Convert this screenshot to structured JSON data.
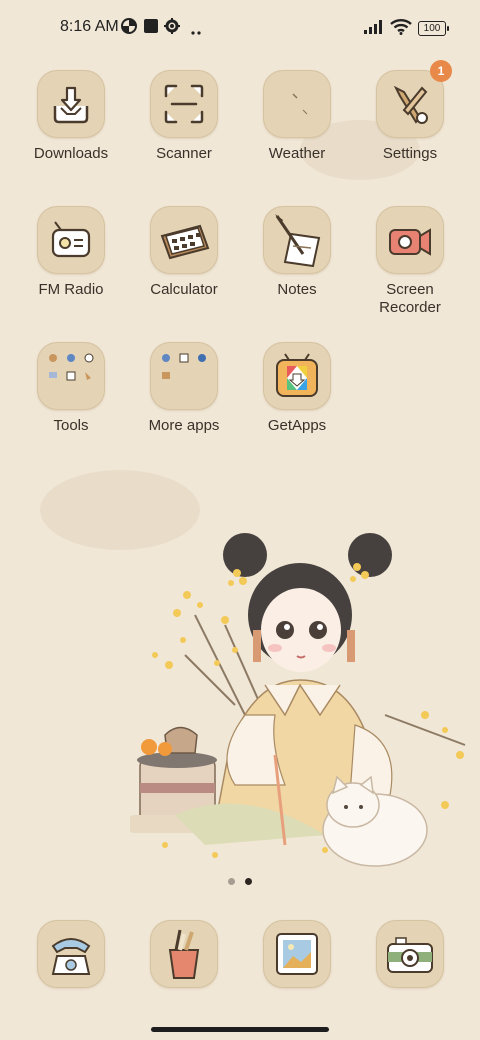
{
  "status_bar": {
    "time": "8:16 AM",
    "icons": [
      "data-saver-icon",
      "square-notification-icon",
      "settings-gear-icon",
      "more-dots-icon"
    ],
    "signal": "signal-bars-icon",
    "wifi": "wifi-icon",
    "battery": "100"
  },
  "apps": [
    {
      "label": "Downloads",
      "icon": "download-tray-icon"
    },
    {
      "label": "Scanner",
      "icon": "scan-frame-icon"
    },
    {
      "label": "Weather",
      "icon": "weather-icon"
    },
    {
      "label": "Settings",
      "icon": "tools-settings-icon",
      "badge": "1"
    },
    {
      "label": "FM Radio",
      "icon": "radio-icon"
    },
    {
      "label": "Calculator",
      "icon": "calculator-icon"
    },
    {
      "label": "Notes",
      "icon": "quill-paper-icon"
    },
    {
      "label": "Screen Recorder",
      "icon": "video-camera-icon"
    },
    {
      "label": "Tools",
      "icon": "folder-tools-icon"
    },
    {
      "label": "More apps",
      "icon": "folder-more-apps-icon"
    },
    {
      "label": "GetApps",
      "icon": "getapps-tv-icon"
    }
  ],
  "pager": {
    "pages": 2,
    "current_index": 1
  },
  "dock": [
    {
      "icon": "telephone-icon"
    },
    {
      "icon": "message-pencil-cup-icon"
    },
    {
      "icon": "gallery-picture-icon"
    },
    {
      "icon": "camera-icon"
    }
  ],
  "colors": {
    "background": "#f1e7d6",
    "tile": "#e4d4b5",
    "badge": "#e8894a",
    "text": "#3a322a"
  }
}
